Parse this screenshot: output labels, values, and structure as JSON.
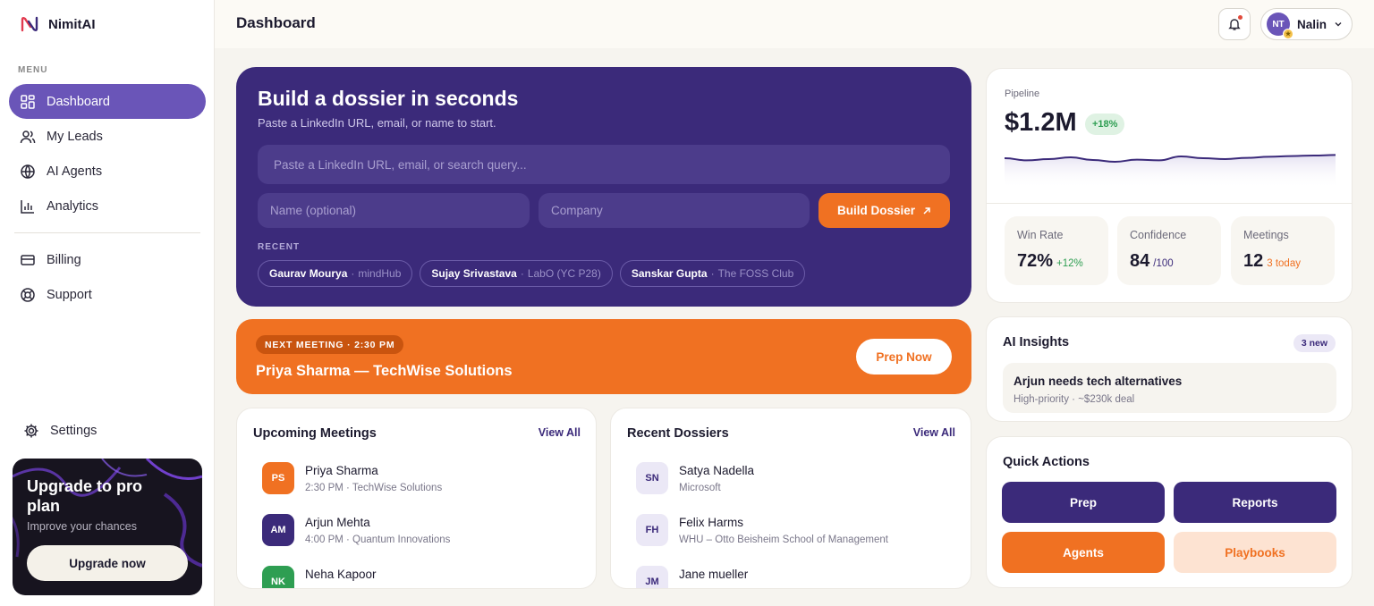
{
  "app": {
    "name": "NimitAI"
  },
  "sidebar": {
    "menu_label": "MENU",
    "items": [
      {
        "label": "Dashboard",
        "icon": "grid-icon",
        "active": true
      },
      {
        "label": "My Leads",
        "icon": "users-icon"
      },
      {
        "label": "AI Agents",
        "icon": "globe-icon"
      },
      {
        "label": "Analytics",
        "icon": "chart-icon"
      }
    ],
    "items2": [
      {
        "label": "Billing",
        "icon": "card-icon"
      },
      {
        "label": "Support",
        "icon": "lifebuoy-icon"
      }
    ],
    "settings_label": "Settings"
  },
  "upgrade": {
    "title": "Upgrade to pro plan",
    "subtitle": "Improve your chances",
    "button": "Upgrade now"
  },
  "header": {
    "title": "Dashboard",
    "user_initials": "NT",
    "user_name": "Nalin"
  },
  "hero": {
    "title": "Build a dossier in seconds",
    "subtitle": "Paste a LinkedIn URL, email, or name to start.",
    "main_placeholder": "Paste a LinkedIn URL, email, or search query...",
    "name_placeholder": "Name (optional)",
    "company_placeholder": "Company",
    "build_button": "Build Dossier",
    "recent_label": "RECENT",
    "recent": [
      {
        "name": "Gaurav Mourya",
        "org": "mindHub"
      },
      {
        "name": "Sujay Srivastava",
        "org": "LabO (YC P28)"
      },
      {
        "name": "Sanskar Gupta",
        "org": "The FOSS Club"
      }
    ]
  },
  "next_meeting": {
    "tag": "NEXT MEETING · 2:30 PM",
    "title": "Priya Sharma — TechWise Solutions",
    "button": "Prep Now"
  },
  "upcoming": {
    "title": "Upcoming Meetings",
    "view_all": "View All",
    "items": [
      {
        "initials": "PS",
        "name": "Priya Sharma",
        "detail": "2:30 PM · TechWise Solutions",
        "color": "#f07122"
      },
      {
        "initials": "AM",
        "name": "Arjun Mehta",
        "detail": "4:00 PM · Quantum Innovations",
        "color": "#3b2a7a"
      },
      {
        "initials": "NK",
        "name": "Neha Kapoor",
        "detail": "",
        "color": "#2e9e52"
      }
    ]
  },
  "dossiers": {
    "title": "Recent Dossiers",
    "view_all": "View All",
    "items": [
      {
        "initials": "SN",
        "name": "Satya Nadella",
        "detail": "Microsoft"
      },
      {
        "initials": "FH",
        "name": "Felix Harms",
        "detail": "WHU – Otto Beisheim School of Management"
      },
      {
        "initials": "JM",
        "name": "Jane mueller",
        "detail": ""
      }
    ]
  },
  "pipeline": {
    "label": "Pipeline",
    "value": "$1.2M",
    "change": "+18%",
    "trend": [
      0.5,
      0.62,
      0.55,
      0.45,
      0.6,
      0.7,
      0.58,
      0.62,
      0.4,
      0.5,
      0.55,
      0.48,
      0.42,
      0.38,
      0.35,
      0.32
    ],
    "stats": [
      {
        "label": "Win Rate",
        "value": "72%",
        "sub": "+12%",
        "sub_color": "#2e9e52"
      },
      {
        "label": "Confidence",
        "value": "84",
        "sub": "/100",
        "sub_color": "#3b2a7a"
      },
      {
        "label": "Meetings",
        "value": "12",
        "sub": "3 today",
        "sub_color": "#f07122"
      }
    ]
  },
  "insights": {
    "title": "AI Insights",
    "badge": "3 new",
    "item_title": "Arjun needs tech alternatives",
    "item_detail": "High-priority · ~$230k deal"
  },
  "quick_actions": {
    "title": "Quick Actions",
    "buttons": [
      "Prep",
      "Reports",
      "Agents",
      "Playbooks"
    ]
  },
  "colors": {
    "brand": "#3b2a7a",
    "accent": "#f07122",
    "sidebar_active": "#6a55b8"
  }
}
